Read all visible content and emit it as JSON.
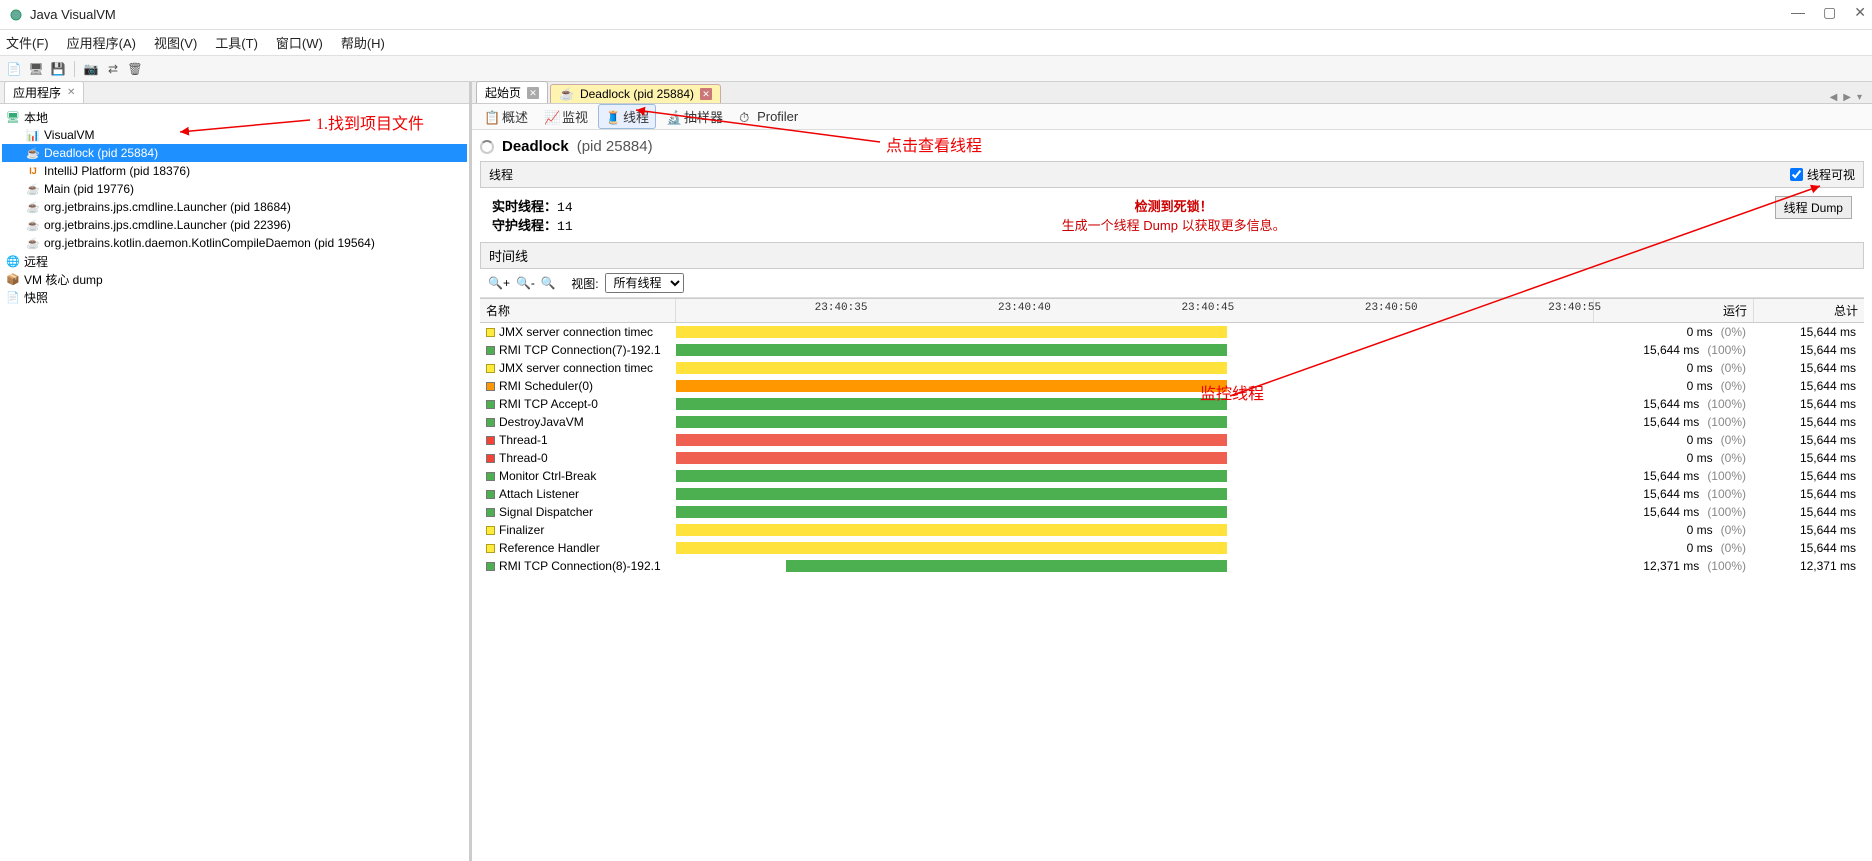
{
  "window": {
    "title": "Java VisualVM"
  },
  "menu": {
    "file": "文件(F)",
    "app": "应用程序(A)",
    "view": "视图(V)",
    "tools": "工具(T)",
    "window": "窗口(W)",
    "help": "帮助(H)"
  },
  "sidebar": {
    "tab": "应用程序",
    "root": "本地",
    "items": [
      {
        "label": "VisualVM",
        "icon": "vvm"
      },
      {
        "label": "Deadlock (pid 25884)",
        "icon": "java",
        "selected": true
      },
      {
        "label": "IntelliJ Platform (pid 18376)",
        "icon": "ij"
      },
      {
        "label": "Main (pid 19776)",
        "icon": "java"
      },
      {
        "label": "org.jetbrains.jps.cmdline.Launcher (pid 18684)",
        "icon": "java"
      },
      {
        "label": "org.jetbrains.jps.cmdline.Launcher (pid 22396)",
        "icon": "java"
      },
      {
        "label": "org.jetbrains.kotlin.daemon.KotlinCompileDaemon (pid 19564)",
        "icon": "java"
      }
    ],
    "remote": "远程",
    "coredump": "VM 核心 dump",
    "snapshot": "快照"
  },
  "right_tabs": {
    "start": "起始页",
    "deadlock": "Deadlock (pid 25884)"
  },
  "subtabs": {
    "overview": "概述",
    "monitor": "监视",
    "threads": "线程",
    "sampler": "抽样器",
    "profiler": "Profiler"
  },
  "app": {
    "title": "Deadlock",
    "pid": "(pid 25884)",
    "thread_section": "线程",
    "visible": "线程可视"
  },
  "stats": {
    "live_label": "实时线程：",
    "live": "14",
    "daemon_label": "守护线程：",
    "daemon": "11",
    "deadlock": "检测到死锁！",
    "hint": "生成一个线程 Dump 以获取更多信息。",
    "dump_btn": "线程 Dump"
  },
  "timeline": {
    "label": "时间线",
    "view_label": "视图:",
    "view_value": "所有线程",
    "ticks": [
      "23:40:35",
      "23:40:40",
      "23:40:45",
      "23:40:50",
      "23:40:55"
    ]
  },
  "columns": {
    "name": "名称",
    "run": "运行",
    "total": "总计"
  },
  "threads": [
    {
      "name": "JMX server connection timec",
      "color": "yellow",
      "bars": [
        {
          "c": "yellow",
          "l": 0,
          "r": 60
        }
      ],
      "run": "0 ms",
      "pct": "(0%)",
      "tot": "15,644 ms"
    },
    {
      "name": "RMI TCP Connection(7)-192.1",
      "color": "green",
      "bars": [
        {
          "c": "green",
          "l": 0,
          "r": 60
        }
      ],
      "run": "15,644 ms",
      "pct": "(100%)",
      "tot": "15,644 ms"
    },
    {
      "name": "JMX server connection timec",
      "color": "yellow",
      "bars": [
        {
          "c": "yellow",
          "l": 0,
          "r": 60
        }
      ],
      "run": "0 ms",
      "pct": "(0%)",
      "tot": "15,644 ms"
    },
    {
      "name": "RMI Scheduler(0)",
      "color": "orange",
      "bars": [
        {
          "c": "orange",
          "l": 0,
          "r": 60
        }
      ],
      "run": "0 ms",
      "pct": "(0%)",
      "tot": "15,644 ms"
    },
    {
      "name": "RMI TCP Accept-0",
      "color": "green",
      "bars": [
        {
          "c": "green",
          "l": 0,
          "r": 60
        }
      ],
      "run": "15,644 ms",
      "pct": "(100%)",
      "tot": "15,644 ms"
    },
    {
      "name": "DestroyJavaVM",
      "color": "green",
      "bars": [
        {
          "c": "green",
          "l": 0,
          "r": 60
        }
      ],
      "run": "15,644 ms",
      "pct": "(100%)",
      "tot": "15,644 ms"
    },
    {
      "name": "Thread-1",
      "color": "red",
      "bars": [
        {
          "c": "red",
          "l": 0,
          "r": 60
        }
      ],
      "run": "0 ms",
      "pct": "(0%)",
      "tot": "15,644 ms"
    },
    {
      "name": "Thread-0",
      "color": "red",
      "bars": [
        {
          "c": "red",
          "l": 0,
          "r": 60
        }
      ],
      "run": "0 ms",
      "pct": "(0%)",
      "tot": "15,644 ms"
    },
    {
      "name": "Monitor Ctrl-Break",
      "color": "green",
      "bars": [
        {
          "c": "green",
          "l": 0,
          "r": 60
        }
      ],
      "run": "15,644 ms",
      "pct": "(100%)",
      "tot": "15,644 ms"
    },
    {
      "name": "Attach Listener",
      "color": "green",
      "bars": [
        {
          "c": "green",
          "l": 0,
          "r": 60
        }
      ],
      "run": "15,644 ms",
      "pct": "(100%)",
      "tot": "15,644 ms"
    },
    {
      "name": "Signal Dispatcher",
      "color": "green",
      "bars": [
        {
          "c": "green",
          "l": 0,
          "r": 60
        }
      ],
      "run": "15,644 ms",
      "pct": "(100%)",
      "tot": "15,644 ms"
    },
    {
      "name": "Finalizer",
      "color": "yellow",
      "bars": [
        {
          "c": "yellow",
          "l": 0,
          "r": 60
        }
      ],
      "run": "0 ms",
      "pct": "(0%)",
      "tot": "15,644 ms"
    },
    {
      "name": "Reference Handler",
      "color": "yellow",
      "bars": [
        {
          "c": "yellow",
          "l": 0,
          "r": 60
        }
      ],
      "run": "0 ms",
      "pct": "(0%)",
      "tot": "15,644 ms"
    },
    {
      "name": "RMI TCP Connection(8)-192.1",
      "color": "green",
      "bars": [
        {
          "c": "green",
          "l": 12,
          "r": 60
        }
      ],
      "run": "12,371 ms",
      "pct": "(100%)",
      "tot": "12,371 ms"
    }
  ],
  "annotations": {
    "find": "1.找到项目文件",
    "threads": "点击查看线程",
    "monitor": "监控线程"
  }
}
